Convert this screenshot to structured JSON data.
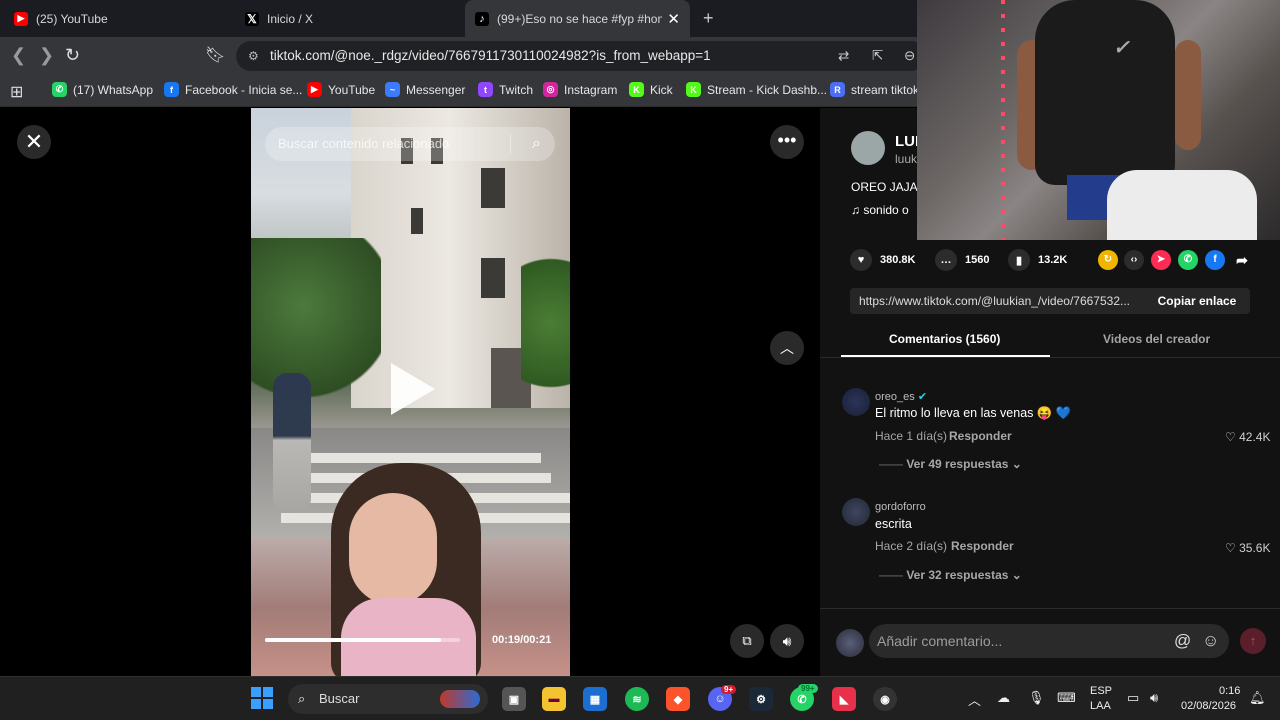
{
  "tabs": [
    {
      "title": "(25) YouTube",
      "favicon": "youtube-icon",
      "active": false
    },
    {
      "title": "Inicio / X",
      "favicon": "x-icon",
      "active": false
    },
    {
      "title": "(99+)Eso no se hace #fyp #hom",
      "favicon": "tiktok-icon",
      "active": true
    }
  ],
  "tab_close_glyph": "✕",
  "new_tab_glyph": "+",
  "address_bar": {
    "url": "tiktok.com/@noe._rdgz/video/7667911730110024982?is_from_webapp=1"
  },
  "bookmarks": [
    {
      "label": "(17) WhatsApp",
      "icon": "whatsapp-icon",
      "color": "#25d366",
      "glyph": "✆"
    },
    {
      "label": "Facebook - Inicia se...",
      "icon": "facebook-icon",
      "color": "#1877f2",
      "glyph": "f"
    },
    {
      "label": "YouTube",
      "icon": "youtube-icon",
      "color": "#ff0000",
      "glyph": "▶"
    },
    {
      "label": "Messenger",
      "icon": "messenger-icon",
      "color": "#3b7bff",
      "glyph": "~"
    },
    {
      "label": "Twitch",
      "icon": "twitch-icon",
      "color": "#9146ff",
      "glyph": "t"
    },
    {
      "label": "Instagram",
      "icon": "instagram-icon",
      "color": "#d6249f",
      "glyph": "◎"
    },
    {
      "label": "Kick",
      "icon": "kick-icon",
      "color": "#53fc18",
      "glyph": "K"
    },
    {
      "label": "Stream - Kick Dashb...",
      "icon": "kick-icon",
      "color": "#53fc18",
      "glyph": "K"
    },
    {
      "label": "stream tiktok",
      "icon": "r-icon",
      "color": "#4c6ef5",
      "glyph": "R"
    }
  ],
  "video": {
    "search_placeholder": "Buscar contenido relacionado",
    "time": "00:19/00:21",
    "progress": 0.9
  },
  "panel": {
    "creator_name": "LUI",
    "creator_handle": "luuk",
    "description": "OREO JAJA",
    "music": "sonido o",
    "stats": {
      "likes": "380.8K",
      "comments": "1560",
      "saves": "13.2K"
    },
    "link": "https://www.tiktok.com/@luukian_/video/7667532...",
    "copy_link": "Copiar enlace",
    "tabs": [
      "Comentarios (1560)",
      "Videos del creador"
    ],
    "comments": [
      {
        "user": "oreo_es",
        "verified": true,
        "text": "El ritmo lo lleva en las venas 😝 💙",
        "time": "Hace 1 día(s)",
        "reply": "Responder",
        "likes": "42.4K",
        "more": "Ver 49 respuestas"
      },
      {
        "user": "gordoforro",
        "verified": false,
        "text": "escrita",
        "time": "Hace 2 día(s)",
        "reply": "Responder",
        "likes": "35.6K",
        "more": "Ver 32 respuestas"
      }
    ],
    "add_comment_placeholder": "Añadir comentario..."
  },
  "taskbar": {
    "search": "Buscar",
    "lang_top": "ESP",
    "lang_bottom": "LAA",
    "time": "0:16",
    "date": "02/08/2026",
    "discord_badge": "9+",
    "whatsapp_badge": "99+"
  }
}
